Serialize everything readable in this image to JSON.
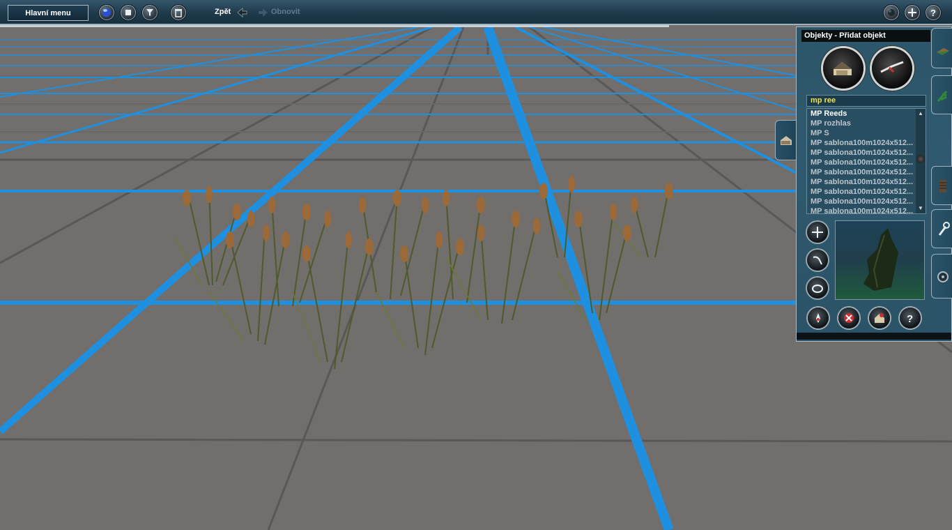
{
  "toolbar": {
    "main_menu_label": "Hlavní menu",
    "undo_label": "Zpět",
    "redo_label": "Obnovit",
    "icons": [
      "globe-icon",
      "stop-icon",
      "filter-icon",
      "trash-icon",
      "night-icon",
      "add-icon",
      "help-icon"
    ]
  },
  "panel": {
    "title": "Objekty - Přidat objekt",
    "filter_text": "mp ree",
    "list_items": [
      "MP Reeds",
      "MP rozhlas",
      "MP S",
      "MP sablona100m1024x512...",
      "MP sablona100m1024x512...",
      "MP sablona100m1024x512...",
      "MP sablona100m1024x512...",
      "MP sablona100m1024x512...",
      "MP sablona100m1024x512...",
      "MP sablona100m1024x512...",
      "MP sablona100m1024x512..."
    ],
    "selected_index": 0,
    "side_buttons": [
      "add-icon",
      "rotate-icon",
      "orbit-icon"
    ],
    "bottom_buttons": [
      "eyedropper-icon",
      "delete-icon",
      "object-icon",
      "help-icon"
    ],
    "tabs": [
      "scenery-tab-icon",
      "vegetation-tab-icon",
      "track-tab-icon",
      "tools-tab-icon",
      "settings-tab-icon"
    ]
  },
  "colors": {
    "grid_blue": "#1f8fe0",
    "ground": "#716e6b",
    "panel_bg": "#2c5569",
    "filter_text": "#f2e24a"
  }
}
